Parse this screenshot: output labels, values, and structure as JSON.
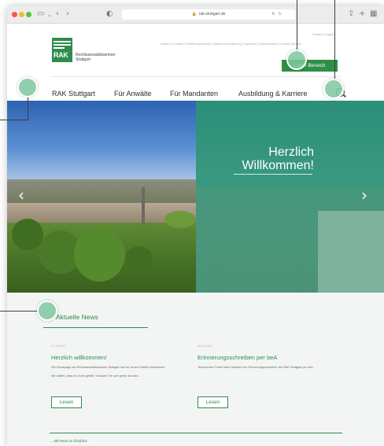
{
  "browser": {
    "url": "rak-stuttgart.de",
    "window_controls": [
      "close",
      "minimize",
      "maximize"
    ],
    "left_icons": [
      "sidebar-icon",
      "chevron-down-icon",
      "back-icon",
      "forward-icon",
      "privacy-icon"
    ],
    "right_icons": [
      "translate-icon",
      "refresh-icon",
      "share-icon",
      "new-tab-icon",
      "tab-overview-icon"
    ]
  },
  "header": {
    "logo_text": "RAK",
    "logo_name_line1": "Rechtsanwaltskammer",
    "logo_name_line2": "Stuttgart",
    "meta_links": "Anfahrt & Kontakt | Fortbildungskalender | Datenschutzerklärung | Impressum | Barrierefreiheit | Leichte Sprache",
    "language_links": "Deutsch | English",
    "login_label": "Login Bereich"
  },
  "nav": {
    "items": [
      "RAK Stuttgart",
      "Für Anwälte",
      "Für Mandanten",
      "Ausbildung & Karriere"
    ]
  },
  "hero": {
    "title_line1": "Herzlich",
    "title_line2": "Willkommen!",
    "prev_arrow": "‹",
    "next_arrow": "›"
  },
  "news": {
    "heading": "Aktuelle News",
    "items": [
      {
        "date": "17.11.2022",
        "title": "Herzlich willkommen!",
        "text": "Die Homepage der Rechtsanwaltskammer Stuttgart hat ein neues Gesicht bekommen.",
        "text2": "Wir hoffen, dass es Ihnen gefällt. Schauen Sie sich gerne auf den...",
        "button": "Lesen"
      },
      {
        "date": "12.11.2022",
        "title": "Erinnerungsschreiben per beA",
        "text": "Technischer Fehler beim Versand von Erinnerungsschreiben der RAK Stuttgart per beA.",
        "text2": "",
        "button": "Lesen"
      }
    ],
    "all_news_label": "→  alle News im Überblick"
  },
  "colors": {
    "brand_green": "#2e8b4d",
    "hero_overlay": "#2c8f78",
    "annotation_circle": "#7ec8a0",
    "annotation_line": "#3d3d3d"
  }
}
